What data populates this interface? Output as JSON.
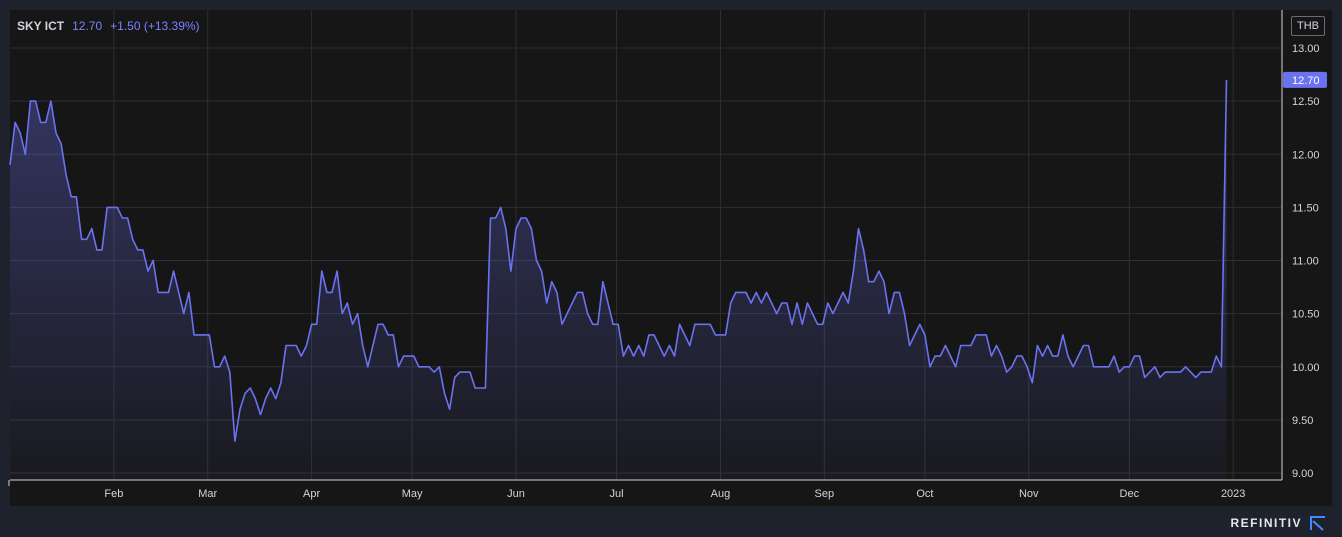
{
  "legend": {
    "symbol": "SKY ICT",
    "last": "12.70",
    "change": "+1.50 (+13.39%)"
  },
  "currency": "THB",
  "brand": {
    "name": "REFINITIV",
    "logo_icon": "refinitiv-logo-icon"
  },
  "colors": {
    "background": "#1e222d",
    "plot_background": "#161616",
    "line": "#6b72f0",
    "grid": "#2b2f36",
    "axis_text": "#d1d4dc",
    "badge": "#6b72f0"
  },
  "chart_data": {
    "type": "area",
    "title": "",
    "xlabel": "",
    "ylabel": "",
    "ylim": [
      9.0,
      13.0
    ],
    "grid": true,
    "y_ticks": [
      "13.00",
      "12.50",
      "12.00",
      "11.50",
      "11.00",
      "10.50",
      "10.00",
      "9.50",
      "9.00"
    ],
    "x_ticks": [
      "Feb",
      "Mar",
      "Apr",
      "May",
      "Jun",
      "Jul",
      "Aug",
      "Sep",
      "Oct",
      "Nov",
      "Dec",
      "2023"
    ],
    "last_value_label": "12.70",
    "series": [
      {
        "x_start": "2022-01-01",
        "x_end": "2022-12-30",
        "values": [
          11.9,
          12.3,
          12.2,
          12.0,
          12.5,
          12.5,
          12.3,
          12.3,
          12.5,
          12.2,
          12.1,
          11.8,
          11.6,
          11.6,
          11.2,
          11.2,
          11.3,
          11.1,
          11.1,
          11.5,
          11.5,
          11.5,
          11.4,
          11.4,
          11.2,
          11.1,
          11.1,
          10.9,
          11.0,
          10.7,
          10.7,
          10.7,
          10.9,
          10.7,
          10.5,
          10.7,
          10.3,
          10.3,
          10.3,
          10.3,
          10.0,
          10.0,
          10.1,
          9.95,
          9.3,
          9.6,
          9.75,
          9.8,
          9.7,
          9.55,
          9.7,
          9.8,
          9.7,
          9.85,
          10.2,
          10.2,
          10.2,
          10.1,
          10.2,
          10.4,
          10.4,
          10.9,
          10.7,
          10.7,
          10.9,
          10.5,
          10.6,
          10.4,
          10.5,
          10.2,
          10.0,
          10.2,
          10.4,
          10.4,
          10.3,
          10.3,
          10.0,
          10.1,
          10.1,
          10.1,
          10.0,
          10.0,
          10.0,
          9.95,
          10.0,
          9.75,
          9.6,
          9.9,
          9.95,
          9.95,
          9.95,
          9.8,
          9.8,
          9.8,
          11.4,
          11.4,
          11.5,
          11.3,
          10.9,
          11.3,
          11.4,
          11.4,
          11.3,
          11.0,
          10.9,
          10.6,
          10.8,
          10.7,
          10.4,
          10.5,
          10.6,
          10.7,
          10.7,
          10.5,
          10.4,
          10.4,
          10.8,
          10.6,
          10.4,
          10.4,
          10.1,
          10.2,
          10.1,
          10.2,
          10.1,
          10.3,
          10.3,
          10.2,
          10.1,
          10.2,
          10.1,
          10.4,
          10.3,
          10.2,
          10.4,
          10.4,
          10.4,
          10.4,
          10.3,
          10.3,
          10.3,
          10.6,
          10.7,
          10.7,
          10.7,
          10.6,
          10.7,
          10.6,
          10.7,
          10.6,
          10.5,
          10.6,
          10.6,
          10.4,
          10.6,
          10.4,
          10.6,
          10.5,
          10.4,
          10.4,
          10.6,
          10.5,
          10.6,
          10.7,
          10.6,
          10.9,
          11.3,
          11.1,
          10.8,
          10.8,
          10.9,
          10.8,
          10.5,
          10.7,
          10.7,
          10.5,
          10.2,
          10.3,
          10.4,
          10.3,
          10.0,
          10.1,
          10.1,
          10.2,
          10.1,
          10.0,
          10.2,
          10.2,
          10.2,
          10.3,
          10.3,
          10.3,
          10.1,
          10.2,
          10.1,
          9.95,
          10.0,
          10.1,
          10.1,
          10.0,
          9.85,
          10.2,
          10.1,
          10.2,
          10.1,
          10.1,
          10.3,
          10.1,
          10.0,
          10.1,
          10.2,
          10.2,
          10.0,
          10.0,
          10.0,
          10.0,
          10.1,
          9.95,
          10.0,
          10.0,
          10.1,
          10.1,
          9.9,
          9.95,
          10.0,
          9.9,
          9.95,
          9.95,
          9.95,
          9.95,
          10.0,
          9.95,
          9.9,
          9.95,
          9.95,
          9.95,
          10.1,
          10.0,
          12.7
        ]
      }
    ]
  }
}
